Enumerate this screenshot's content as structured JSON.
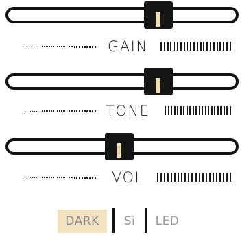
{
  "sliders": [
    {
      "id": "gain",
      "label": "GAIN",
      "value": 0.66
    },
    {
      "id": "tone",
      "label": "TONE",
      "value": 0.66
    },
    {
      "id": "vol",
      "label": "VOL",
      "value": 0.48
    }
  ],
  "modes": {
    "dark": "DARK",
    "si": "Si",
    "led": "LED",
    "selected": "DARK"
  },
  "colors": {
    "knob": "#151515",
    "knob_mark": "#ecdcb8",
    "track_border": "#111111",
    "active_mode_bg": "#f2e2c0",
    "mode_text": "#9a9a9a"
  }
}
